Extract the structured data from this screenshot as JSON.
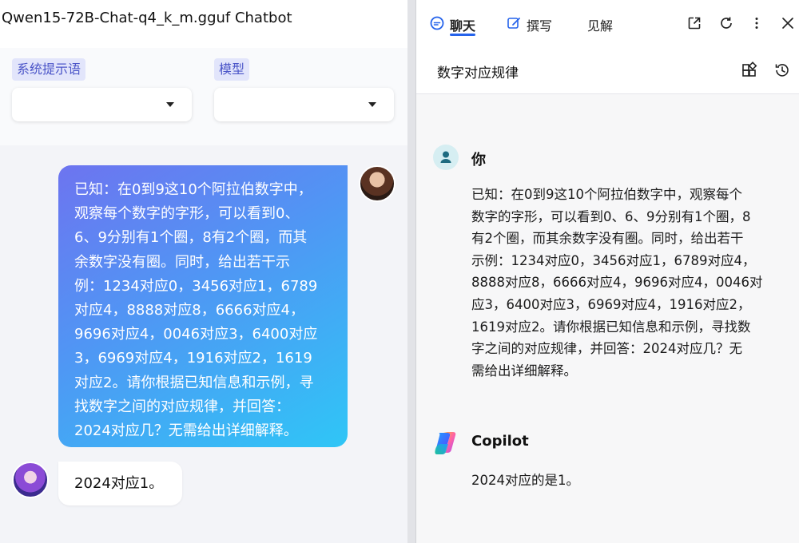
{
  "chatbot": {
    "title": "Qwen15-72B-Chat-q4_k_m.gguf Chatbot",
    "system_prompt_label": "系统提示语",
    "system_prompt_value": "",
    "model_label": "模型",
    "model_value": "",
    "messages": [
      {
        "role": "user",
        "text": "已知：在0到9这10个阿拉伯数字中，\n观察每个数字的字形，可以看到0、\n6、9分别有1个圈，8有2个圈，而其\n余数字没有圈。同时，给出若干示\n例：1234对应0，3456对应1，6789\n对应4，8888对应8，6666对应4，\n9696对应4，0046对应3，6400对应\n3，6969对应4，1916对应2，1619\n对应2。请你根据已知信息和示例，寻\n找数字之间的对应规律，并回答：\n2024对应几？无需给出详细解释。"
      },
      {
        "role": "assistant",
        "text": "2024对应1。"
      }
    ]
  },
  "copilot": {
    "tabs": [
      {
        "label": "聊天",
        "icon": "chat-icon"
      },
      {
        "label": "撰写",
        "icon": "compose-icon"
      },
      {
        "label": "见解",
        "icon": ""
      }
    ],
    "conversation_title": "数字对应规律",
    "user_name": "你",
    "user_message": "已知：在0到9这10个阿拉伯数字中，观察每个\n数字的字形，可以看到0、6、9分别有1个圈，8\n有2个圈，而其余数字没有圈。同时，给出若干\n示例：1234对应0，3456对应1，6789对应4，\n8888对应8，6666对应4，9696对应4，0046对\n应3，6400对应3，6969对应4，1916对应2，\n1619对应2。请你根据已知信息和示例，寻找数\n字之间的对应规律，并回答：2024对应几？无\n需给出详细解释。",
    "bot_name": "Copilot",
    "bot_message": "2024对应的是1。"
  },
  "colors": {
    "accent": "#2563eb",
    "label_bg": "#e2e5fb",
    "label_text": "#4b55c8",
    "bubble_gradient_start": "#6d74f0",
    "bubble_gradient_end": "#2fc6f6"
  }
}
